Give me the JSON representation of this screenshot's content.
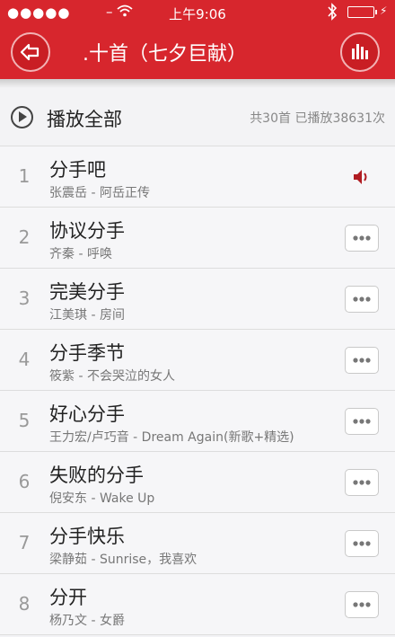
{
  "status": {
    "signal": "●●●●●",
    "dash_left": "–",
    "dash_right": "–",
    "time": "上午9:06"
  },
  "header": {
    "title": ".十首（七夕巨献）"
  },
  "play_all": {
    "label": "播放全部",
    "stats": "共30首 已播放38631次"
  },
  "tracks": [
    {
      "num": "1",
      "title": "分手吧",
      "subtitle": "张震岳 - 阿岳正传",
      "playing": true
    },
    {
      "num": "2",
      "title": "协议分手",
      "subtitle": "齐秦 - 呼唤"
    },
    {
      "num": "3",
      "title": "完美分手",
      "subtitle": "江美琪 - 房间"
    },
    {
      "num": "4",
      "title": "分手季节",
      "subtitle": "筱紫 - 不会哭泣的女人"
    },
    {
      "num": "5",
      "title": "好心分手",
      "subtitle": "王力宏/卢巧音 - Dream Again(新歌+精选)"
    },
    {
      "num": "6",
      "title": "失败的分手",
      "subtitle": "倪安东 - Wake Up"
    },
    {
      "num": "7",
      "title": "分手快乐",
      "subtitle": "梁静茹 - Sunrise，我喜欢"
    },
    {
      "num": "8",
      "title": "分开",
      "subtitle": "杨乃文 - 女爵"
    }
  ],
  "colors": {
    "accent": "#d7262d",
    "playing": "#b01c22"
  }
}
